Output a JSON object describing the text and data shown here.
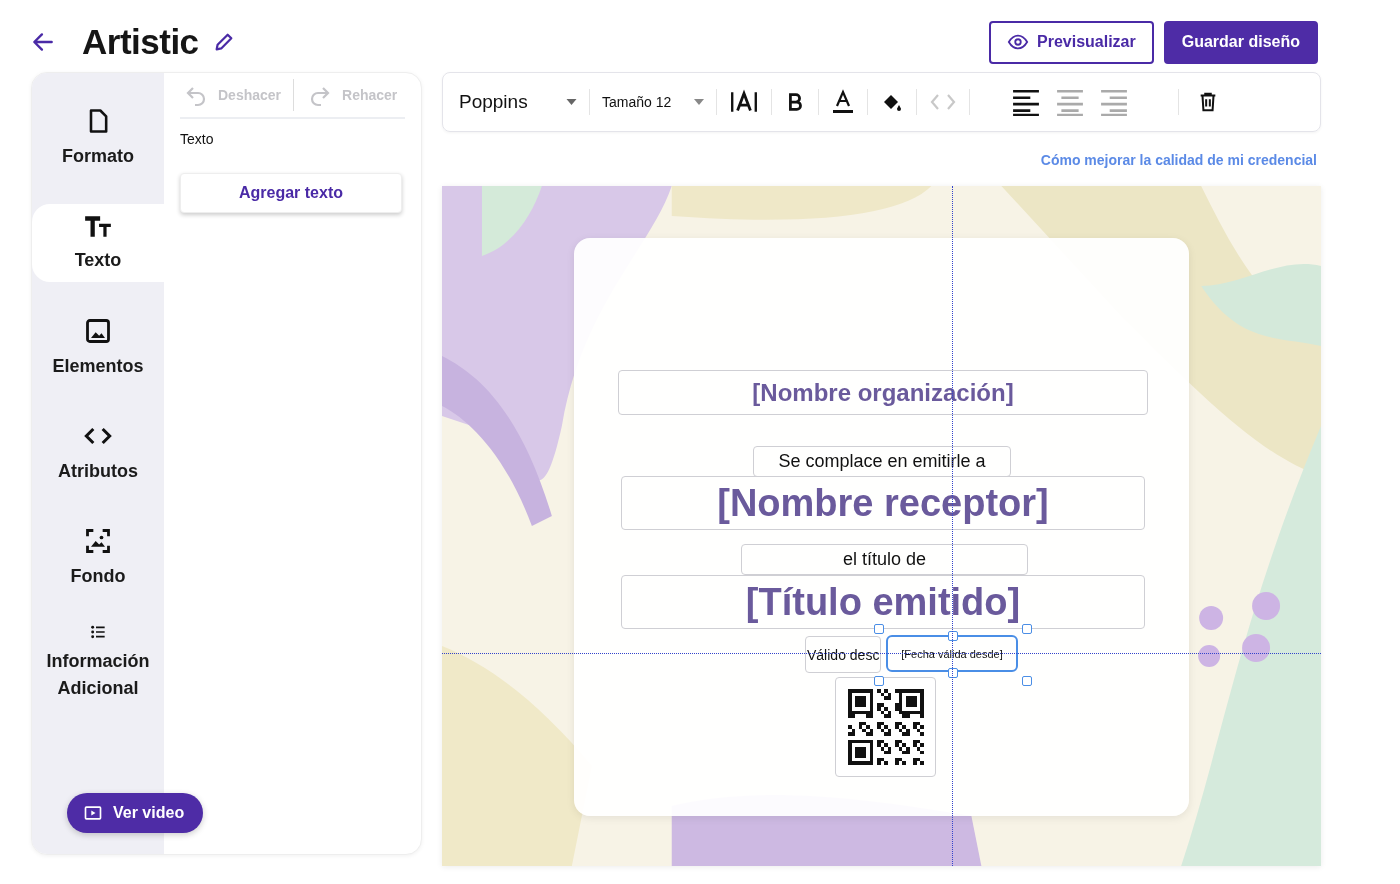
{
  "header": {
    "title": "Artistic"
  },
  "actions": [
    {
      "label": "Previsualizar",
      "kind": "outline"
    },
    {
      "label": "Guardar diseño",
      "kind": "primary"
    }
  ],
  "sidebar": {
    "items": [
      {
        "label": "Formato",
        "selected": false
      },
      {
        "label": "Texto",
        "selected": true
      },
      {
        "label": "Elementos",
        "selected": false
      },
      {
        "label": "Atributos",
        "selected": false
      },
      {
        "label": "Fondo",
        "selected": false
      },
      {
        "label": "Información Adicional",
        "selected": false
      }
    ]
  },
  "history": [
    {
      "label": "Deshacer",
      "disabled": true
    },
    {
      "label": "Rehacer",
      "disabled": true
    }
  ],
  "panel": {
    "section_label": "Texto",
    "add_button": "Agregar texto"
  },
  "video_button": "Ver video",
  "toolbar": {
    "font": "Poppins",
    "size": "Tamaño 12",
    "code_disabled": true,
    "alignments": [
      {
        "selected": true
      },
      {
        "selected": false
      },
      {
        "selected": false
      }
    ]
  },
  "help_link": "Cómo mejorar la calidad de mi credencial",
  "certificate": {
    "fields": [
      {
        "kind": "heading",
        "text": "[Nombre organización]",
        "selected": false
      },
      {
        "kind": "caption",
        "text": "Se complace en emitirle a",
        "selected": false
      },
      {
        "kind": "display",
        "text": "[Nombre receptor]",
        "selected": false
      },
      {
        "kind": "caption",
        "text": "el título de",
        "selected": false
      },
      {
        "kind": "display",
        "text": "[Título emitido]",
        "selected": false
      },
      {
        "kind": "label",
        "text": "Válido desc",
        "selected": false
      },
      {
        "kind": "small",
        "text": "[Fecha válida desde]",
        "selected": true
      },
      {
        "kind": "qr",
        "selected": false
      }
    ]
  }
}
